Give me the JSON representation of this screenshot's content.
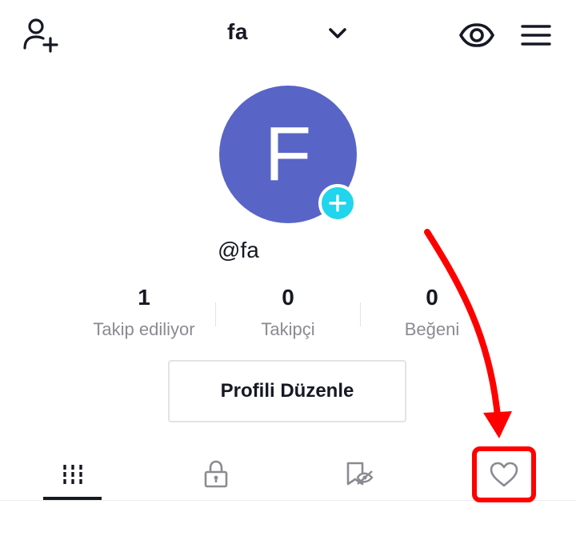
{
  "header": {
    "username": "fa",
    "add_friend_icon": "person-plus-icon",
    "dropdown_icon": "chevron-down-icon",
    "view_icon": "eye-icon",
    "menu_icon": "hamburger-menu-icon"
  },
  "profile": {
    "avatar_letter": "F",
    "avatar_color": "#5865c6",
    "add_badge_color": "#20d5ec",
    "handle": "@fa"
  },
  "stats": [
    {
      "value": "1",
      "label": "Takip ediliyor"
    },
    {
      "value": "0",
      "label": "Takipçi"
    },
    {
      "value": "0",
      "label": "Beğeni"
    }
  ],
  "edit_profile_label": "Profili Düzenle",
  "tabs": [
    {
      "icon": "grid-icon",
      "active": true
    },
    {
      "icon": "lock-icon",
      "active": false
    },
    {
      "icon": "hidden-bookmark-icon",
      "active": false
    },
    {
      "icon": "heart-icon",
      "active": false
    }
  ],
  "annotation": {
    "color": "#ff0000",
    "target": "heart-tab"
  }
}
